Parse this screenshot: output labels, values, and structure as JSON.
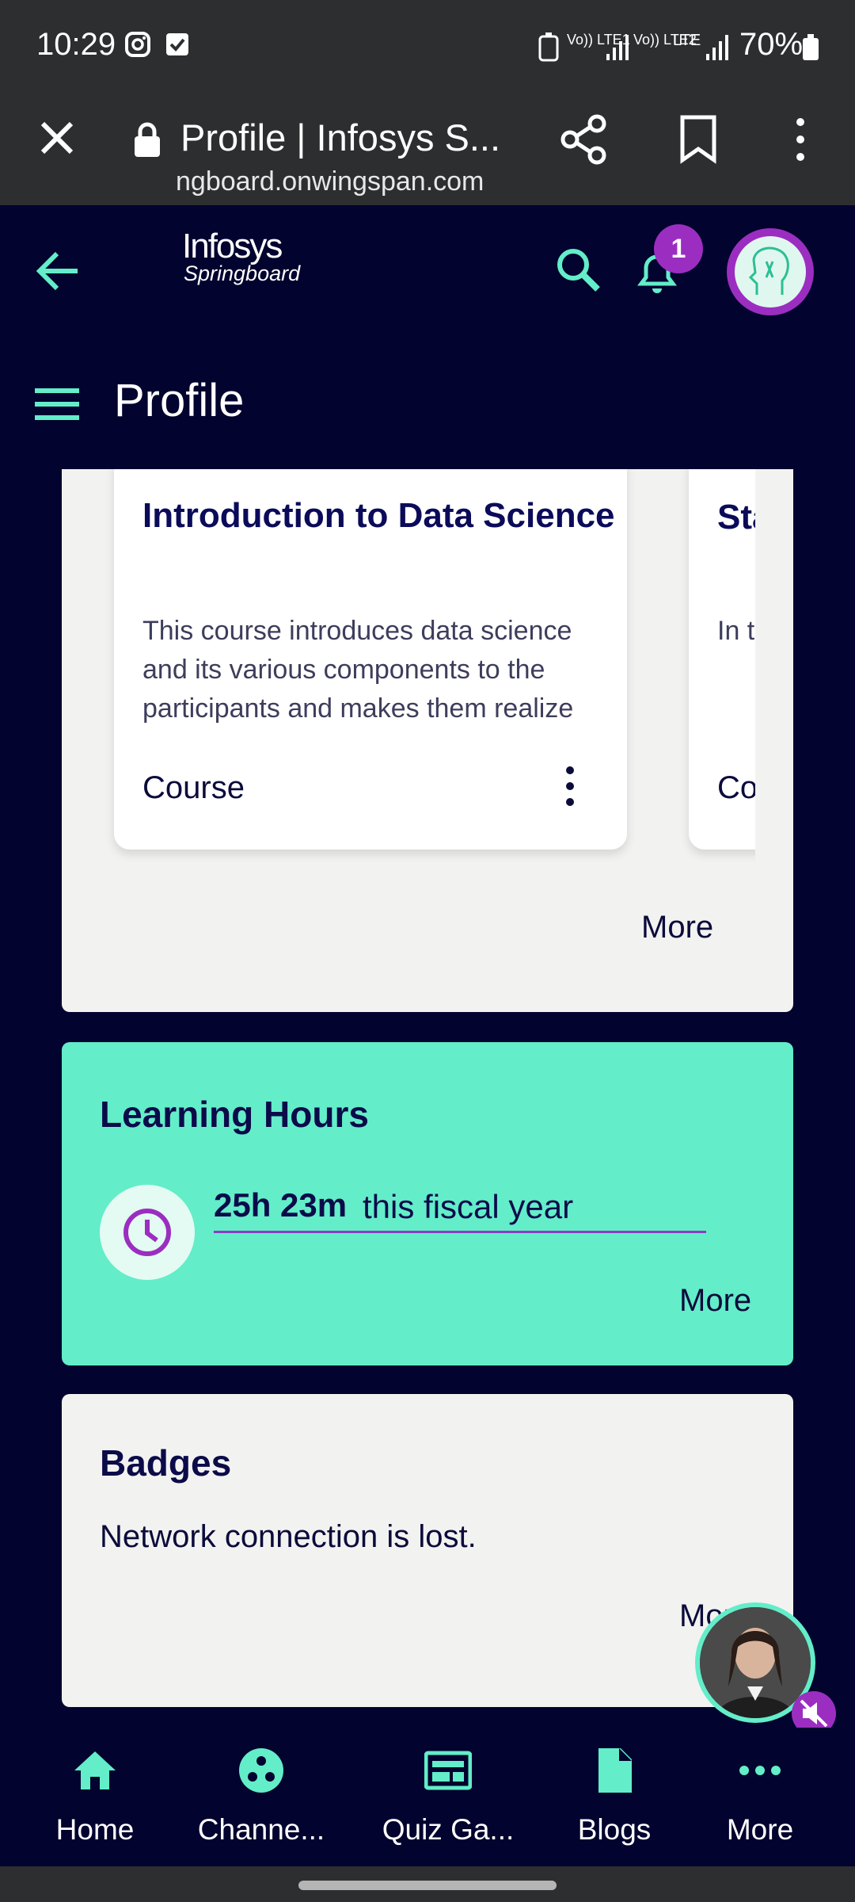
{
  "status": {
    "time": "10:29",
    "network1": "Vo)) LTE1",
    "network2": "Vo)) LTE2",
    "lte": "LTE",
    "battery": "70%"
  },
  "browser": {
    "title": "Profile | Infosys S...",
    "url": "ngboard.onwingspan.com"
  },
  "header": {
    "logo_line1": "Infosys",
    "logo_line2": "Springboard",
    "notification_count": "1",
    "page_title": "Profile"
  },
  "courses": {
    "card1": {
      "title": "Introduction to Data Science",
      "description": "This course introduces data science and its various components to the participants and makes them realize",
      "type": "Course"
    },
    "card2": {
      "title": "Sta Dis",
      "description": "In t wic for",
      "type": "Co"
    },
    "more": "More"
  },
  "learning": {
    "title": "Learning Hours",
    "hours": "25h 23m",
    "period": "this fiscal year",
    "more": "More"
  },
  "badges": {
    "title": "Badges",
    "message": "Network connection is lost.",
    "more": "More"
  },
  "nav": [
    {
      "label": "Home",
      "icon": "home-icon"
    },
    {
      "label": "Channe...",
      "icon": "channels-icon"
    },
    {
      "label": "Quiz Ga...",
      "icon": "quiz-icon"
    },
    {
      "label": "Blogs",
      "icon": "blog-icon"
    },
    {
      "label": "More",
      "icon": "more-icon"
    }
  ],
  "colors": {
    "accent": "#63edc9",
    "purple": "#9b2ec0",
    "navy": "#02032e"
  }
}
